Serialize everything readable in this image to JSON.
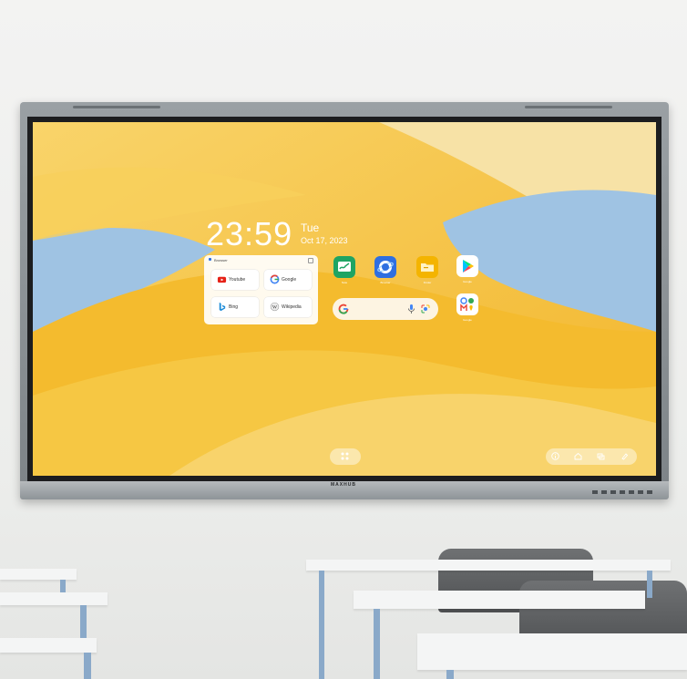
{
  "clock": {
    "time": "23:59",
    "day": "Tue",
    "date": "Oct 17, 2023"
  },
  "browser_widget": {
    "title": "Browser",
    "shortcuts": [
      {
        "label": "Youtube",
        "icon": "youtube-icon"
      },
      {
        "label": "Google",
        "icon": "google-icon"
      },
      {
        "label": "Bing",
        "icon": "bing-icon"
      },
      {
        "label": "Wikipedia",
        "icon": "wikipedia-icon"
      }
    ]
  },
  "apps": [
    {
      "label": "Note",
      "icon": "note-app-icon",
      "color": "#1fa463"
    },
    {
      "label": "Browser",
      "icon": "browser-app-icon",
      "color": "#2f6fe0"
    },
    {
      "label": "Finder",
      "icon": "files-app-icon",
      "color": "#f4b400"
    },
    {
      "label": "Google",
      "icon": "play-store-icon",
      "color": "#ffffff"
    },
    {
      "label": "Google",
      "icon": "google-apps-folder-icon",
      "color": "#ffffff"
    }
  ],
  "search": {
    "icon": "google-g-icon"
  },
  "dock": {
    "left": [
      "apps-grid-icon"
    ],
    "right": [
      "info-icon",
      "home-icon",
      "windows-icon",
      "annotate-icon"
    ]
  },
  "brand": "MAXHUB",
  "colors": {
    "wallpaper_yellow": "#f6c23c",
    "wallpaper_blue": "#9fc3e3",
    "bezel": "#1c1d1f"
  }
}
